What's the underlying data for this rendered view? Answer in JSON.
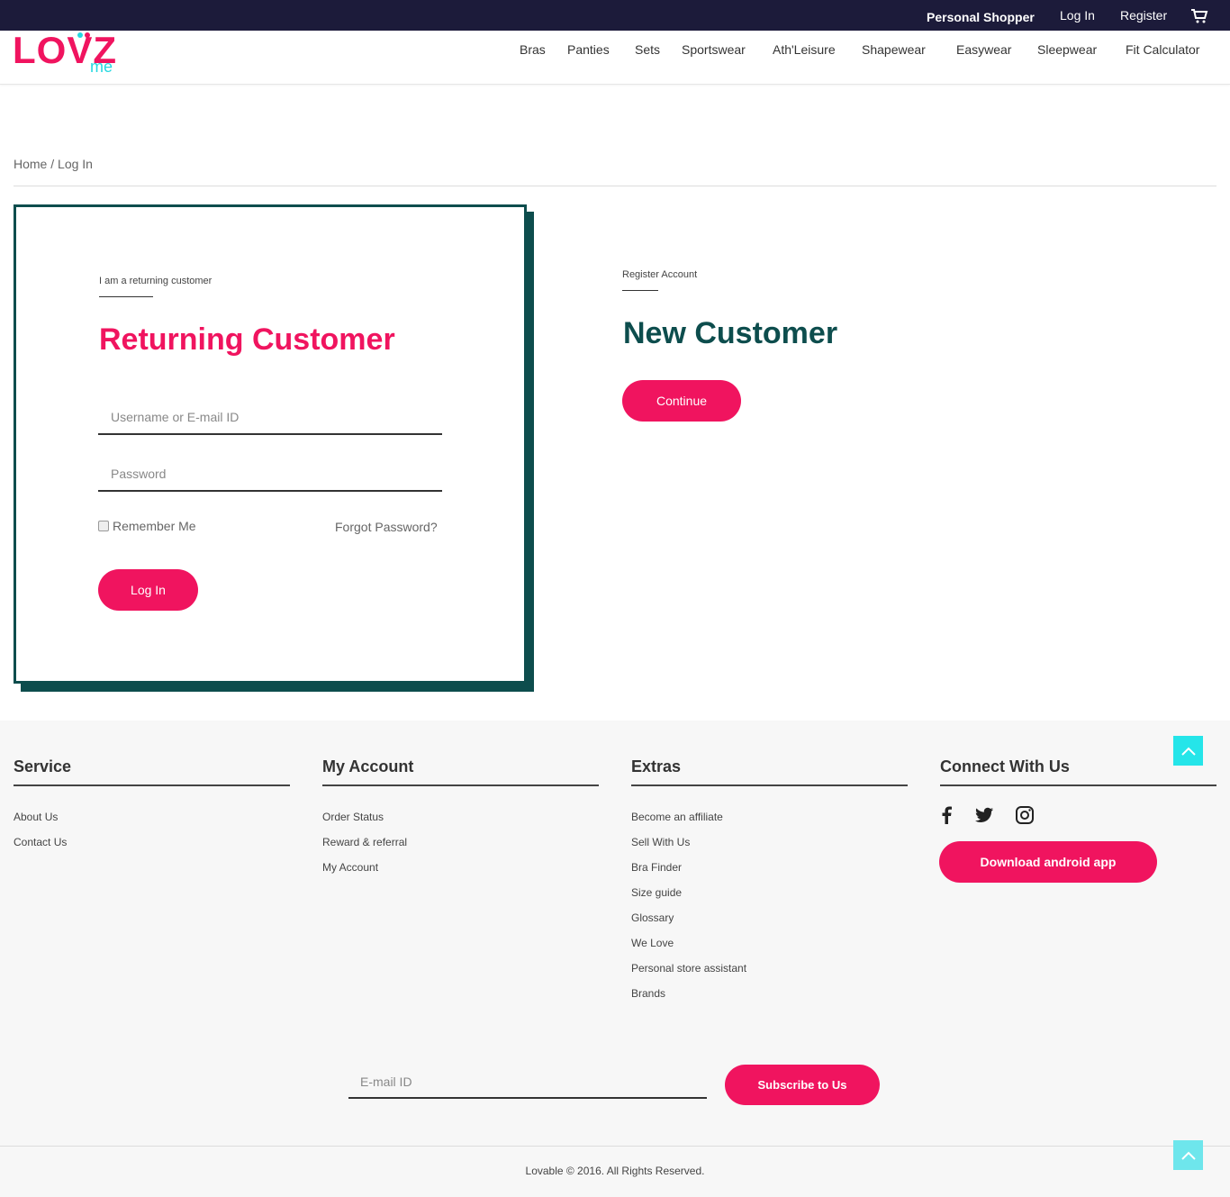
{
  "topbar": {
    "personal_shopper": "Personal Shopper",
    "login": "Log In",
    "register": "Register",
    "cart_icon": "cart-icon"
  },
  "logo": {
    "main": "LOVZ",
    "sub": "me"
  },
  "nav": [
    "Bras",
    "Panties",
    "Sets",
    "Sportswear",
    "Ath'Leisure",
    "Shapewear",
    "Easywear",
    "Sleepwear",
    "Fit Calculator"
  ],
  "breadcrumb": {
    "home": "Home",
    "separator": " / ",
    "current": "Log In"
  },
  "returning": {
    "label": "I am a returning customer",
    "title": "Returning Customer",
    "username_placeholder": "Username or E-mail ID",
    "password_placeholder": "Password",
    "remember": "Remember Me",
    "forgot": "Forgot Password?",
    "login_button": "Log In"
  },
  "new_customer": {
    "label": "Register Account",
    "title": "New Customer",
    "continue_button": "Continue"
  },
  "footer": {
    "service": {
      "title": "Service",
      "links": [
        "About Us",
        "Contact Us"
      ]
    },
    "account": {
      "title": "My Account",
      "links": [
        "Order Status",
        "Reward & referral",
        "My Account"
      ]
    },
    "extras": {
      "title": "Extras",
      "links": [
        "Become an affiliate",
        "Sell With Us",
        "Bra Finder",
        "Size guide",
        "Glossary",
        "We Love",
        "Personal store assistant",
        "Brands"
      ]
    },
    "connect": {
      "title": "Connect With Us",
      "android_button": "Download android app"
    },
    "email_placeholder": "E-mail ID",
    "subscribe_button": "Subscribe to Us",
    "copyright": "Lovable © 2016. All Rights Reserved."
  },
  "colors": {
    "pink": "#f0145f",
    "teal": "#0d4d4d",
    "cyan": "#25e5e9",
    "navy": "#1c1b3a"
  }
}
